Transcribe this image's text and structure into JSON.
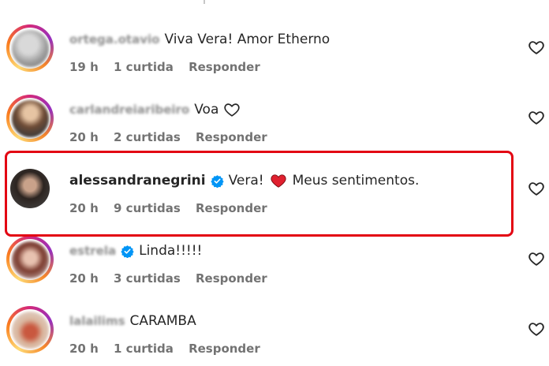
{
  "comments": [
    {
      "username": "ortega.otavio",
      "text": "Viva Vera! Amor Etherno",
      "time": "19 h",
      "likes": "1 curtida",
      "reply": "Responder",
      "verified": false,
      "avatar_style": "story-ring"
    },
    {
      "username": "carlandreiaribeiro",
      "text": "Voa",
      "inline_icon": "heart-outline-icon",
      "time": "20 h",
      "likes": "2 curtidas",
      "reply": "Responder",
      "verified": false,
      "avatar_style": "story-ring"
    },
    {
      "username": "alessandranegrini",
      "text": "Vera!",
      "inline_icon": "red-heart-icon",
      "text_after": "Meus sentimentos.",
      "time": "20 h",
      "likes": "9 curtidas",
      "reply": "Responder",
      "verified": true,
      "highlighted": true,
      "avatar_style": "plain"
    },
    {
      "username": "estrela",
      "text": "Linda!!!!!",
      "time": "20 h",
      "likes": "3 curtidas",
      "reply": "Responder",
      "verified": true,
      "avatar_style": "story-ring"
    },
    {
      "username": "lalailims",
      "text": "CARAMBA",
      "time": "20 h",
      "likes": "1 curtida",
      "reply": "Responder",
      "verified": false,
      "avatar_style": "story-ring"
    }
  ],
  "colors": {
    "highlight_border": "#e30613",
    "verified_blue": "#0095f6",
    "heart_red": "#e0202f",
    "meta_gray": "#737373"
  }
}
